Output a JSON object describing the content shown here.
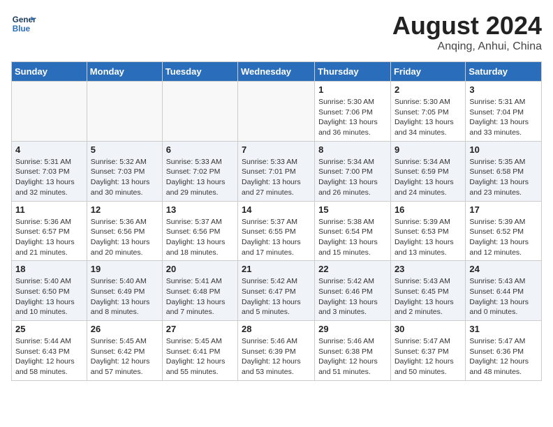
{
  "header": {
    "logo_line1": "General",
    "logo_line2": "Blue",
    "month": "August 2024",
    "location": "Anqing, Anhui, China"
  },
  "weekdays": [
    "Sunday",
    "Monday",
    "Tuesday",
    "Wednesday",
    "Thursday",
    "Friday",
    "Saturday"
  ],
  "weeks": [
    [
      {
        "day": "",
        "info": ""
      },
      {
        "day": "",
        "info": ""
      },
      {
        "day": "",
        "info": ""
      },
      {
        "day": "",
        "info": ""
      },
      {
        "day": "1",
        "info": "Sunrise: 5:30 AM\nSunset: 7:06 PM\nDaylight: 13 hours\nand 36 minutes."
      },
      {
        "day": "2",
        "info": "Sunrise: 5:30 AM\nSunset: 7:05 PM\nDaylight: 13 hours\nand 34 minutes."
      },
      {
        "day": "3",
        "info": "Sunrise: 5:31 AM\nSunset: 7:04 PM\nDaylight: 13 hours\nand 33 minutes."
      }
    ],
    [
      {
        "day": "4",
        "info": "Sunrise: 5:31 AM\nSunset: 7:03 PM\nDaylight: 13 hours\nand 32 minutes."
      },
      {
        "day": "5",
        "info": "Sunrise: 5:32 AM\nSunset: 7:03 PM\nDaylight: 13 hours\nand 30 minutes."
      },
      {
        "day": "6",
        "info": "Sunrise: 5:33 AM\nSunset: 7:02 PM\nDaylight: 13 hours\nand 29 minutes."
      },
      {
        "day": "7",
        "info": "Sunrise: 5:33 AM\nSunset: 7:01 PM\nDaylight: 13 hours\nand 27 minutes."
      },
      {
        "day": "8",
        "info": "Sunrise: 5:34 AM\nSunset: 7:00 PM\nDaylight: 13 hours\nand 26 minutes."
      },
      {
        "day": "9",
        "info": "Sunrise: 5:34 AM\nSunset: 6:59 PM\nDaylight: 13 hours\nand 24 minutes."
      },
      {
        "day": "10",
        "info": "Sunrise: 5:35 AM\nSunset: 6:58 PM\nDaylight: 13 hours\nand 23 minutes."
      }
    ],
    [
      {
        "day": "11",
        "info": "Sunrise: 5:36 AM\nSunset: 6:57 PM\nDaylight: 13 hours\nand 21 minutes."
      },
      {
        "day": "12",
        "info": "Sunrise: 5:36 AM\nSunset: 6:56 PM\nDaylight: 13 hours\nand 20 minutes."
      },
      {
        "day": "13",
        "info": "Sunrise: 5:37 AM\nSunset: 6:56 PM\nDaylight: 13 hours\nand 18 minutes."
      },
      {
        "day": "14",
        "info": "Sunrise: 5:37 AM\nSunset: 6:55 PM\nDaylight: 13 hours\nand 17 minutes."
      },
      {
        "day": "15",
        "info": "Sunrise: 5:38 AM\nSunset: 6:54 PM\nDaylight: 13 hours\nand 15 minutes."
      },
      {
        "day": "16",
        "info": "Sunrise: 5:39 AM\nSunset: 6:53 PM\nDaylight: 13 hours\nand 13 minutes."
      },
      {
        "day": "17",
        "info": "Sunrise: 5:39 AM\nSunset: 6:52 PM\nDaylight: 13 hours\nand 12 minutes."
      }
    ],
    [
      {
        "day": "18",
        "info": "Sunrise: 5:40 AM\nSunset: 6:50 PM\nDaylight: 13 hours\nand 10 minutes."
      },
      {
        "day": "19",
        "info": "Sunrise: 5:40 AM\nSunset: 6:49 PM\nDaylight: 13 hours\nand 8 minutes."
      },
      {
        "day": "20",
        "info": "Sunrise: 5:41 AM\nSunset: 6:48 PM\nDaylight: 13 hours\nand 7 minutes."
      },
      {
        "day": "21",
        "info": "Sunrise: 5:42 AM\nSunset: 6:47 PM\nDaylight: 13 hours\nand 5 minutes."
      },
      {
        "day": "22",
        "info": "Sunrise: 5:42 AM\nSunset: 6:46 PM\nDaylight: 13 hours\nand 3 minutes."
      },
      {
        "day": "23",
        "info": "Sunrise: 5:43 AM\nSunset: 6:45 PM\nDaylight: 13 hours\nand 2 minutes."
      },
      {
        "day": "24",
        "info": "Sunrise: 5:43 AM\nSunset: 6:44 PM\nDaylight: 13 hours\nand 0 minutes."
      }
    ],
    [
      {
        "day": "25",
        "info": "Sunrise: 5:44 AM\nSunset: 6:43 PM\nDaylight: 12 hours\nand 58 minutes."
      },
      {
        "day": "26",
        "info": "Sunrise: 5:45 AM\nSunset: 6:42 PM\nDaylight: 12 hours\nand 57 minutes."
      },
      {
        "day": "27",
        "info": "Sunrise: 5:45 AM\nSunset: 6:41 PM\nDaylight: 12 hours\nand 55 minutes."
      },
      {
        "day": "28",
        "info": "Sunrise: 5:46 AM\nSunset: 6:39 PM\nDaylight: 12 hours\nand 53 minutes."
      },
      {
        "day": "29",
        "info": "Sunrise: 5:46 AM\nSunset: 6:38 PM\nDaylight: 12 hours\nand 51 minutes."
      },
      {
        "day": "30",
        "info": "Sunrise: 5:47 AM\nSunset: 6:37 PM\nDaylight: 12 hours\nand 50 minutes."
      },
      {
        "day": "31",
        "info": "Sunrise: 5:47 AM\nSunset: 6:36 PM\nDaylight: 12 hours\nand 48 minutes."
      }
    ]
  ]
}
